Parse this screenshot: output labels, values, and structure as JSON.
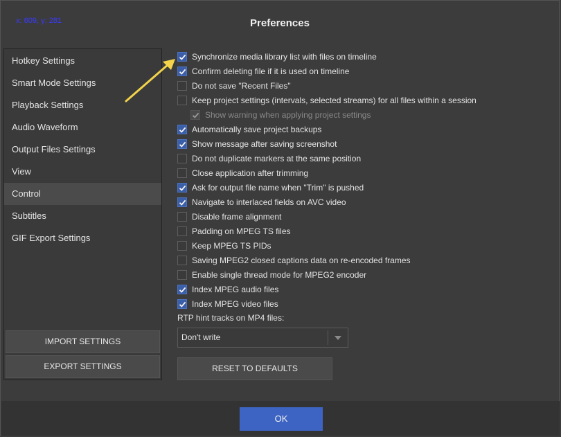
{
  "coordinate_readout": "x: 609, y: 281",
  "window": {
    "title": "Preferences"
  },
  "sidebar": {
    "items": [
      {
        "label": "Hotkey Settings",
        "active": false
      },
      {
        "label": "Smart Mode Settings",
        "active": false
      },
      {
        "label": "Playback Settings",
        "active": false
      },
      {
        "label": "Audio Waveform",
        "active": false
      },
      {
        "label": "Output Files Settings",
        "active": false
      },
      {
        "label": "View",
        "active": false
      },
      {
        "label": "Control",
        "active": true
      },
      {
        "label": "Subtitles",
        "active": false
      },
      {
        "label": "GIF Export Settings",
        "active": false
      }
    ],
    "import_label": "IMPORT SETTINGS",
    "export_label": "EXPORT SETTINGS"
  },
  "options": [
    {
      "label": "Synchronize media library list with files on timeline",
      "checked": true,
      "enabled": true
    },
    {
      "label": "Confirm deleting file if it is used on timeline",
      "checked": true,
      "enabled": true
    },
    {
      "label": "Do not save \"Recent Files\"",
      "checked": false,
      "enabled": true
    },
    {
      "label": "Keep project settings (intervals, selected streams) for all files within a session",
      "checked": false,
      "enabled": true
    },
    {
      "label": "Show warning when applying project settings",
      "checked": true,
      "enabled": false
    },
    {
      "label": "Automatically save project backups",
      "checked": true,
      "enabled": true
    },
    {
      "label": "Show message after saving screenshot",
      "checked": true,
      "enabled": true
    },
    {
      "label": "Do not duplicate markers at the same position",
      "checked": false,
      "enabled": true
    },
    {
      "label": "Close application after trimming",
      "checked": false,
      "enabled": true
    },
    {
      "label": "Ask for output file name when \"Trim\" is pushed",
      "checked": true,
      "enabled": true
    },
    {
      "label": "Navigate to interlaced fields on AVC video",
      "checked": true,
      "enabled": true
    },
    {
      "label": "Disable frame alignment",
      "checked": false,
      "enabled": true
    },
    {
      "label": "Padding on MPEG TS files",
      "checked": false,
      "enabled": true
    },
    {
      "label": "Keep MPEG TS PIDs",
      "checked": false,
      "enabled": true
    },
    {
      "label": "Saving MPEG2 closed captions data on re-encoded frames",
      "checked": false,
      "enabled": true
    },
    {
      "label": "Enable single thread mode for MPEG2 encoder",
      "checked": false,
      "enabled": true
    },
    {
      "label": "Index MPEG audio files",
      "checked": true,
      "enabled": true
    },
    {
      "label": "Index MPEG video files",
      "checked": true,
      "enabled": true
    }
  ],
  "rtp": {
    "label": "RTP hint tracks on MP4 files:",
    "selected": "Don't write"
  },
  "reset_label": "RESET TO DEFAULTS",
  "ok_label": "OK",
  "colors": {
    "accent": "#3d64c2",
    "checkbox_checked": "#3b5ea8",
    "annotation_arrow": "#f2d34a",
    "coordinate_text": "#3a3aff"
  }
}
